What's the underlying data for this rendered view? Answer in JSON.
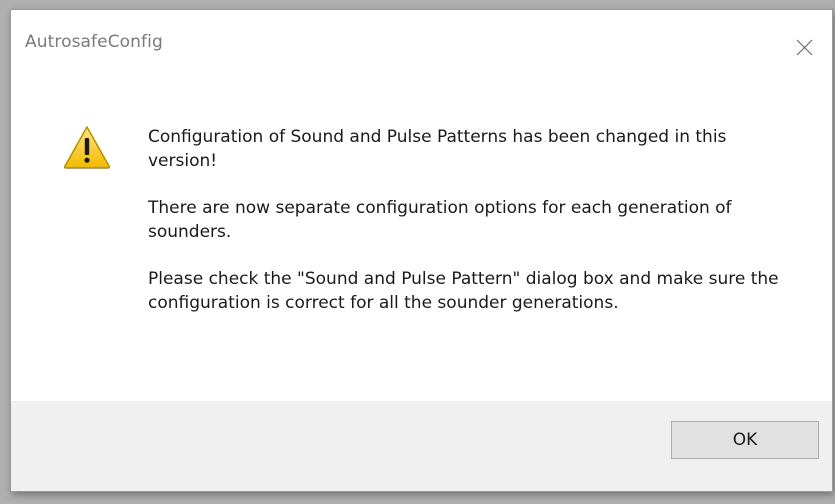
{
  "window": {
    "title": "AutrosafeConfig",
    "close_icon": "close-icon"
  },
  "dialog": {
    "icon": "warning-icon",
    "paragraphs": [
      "Configuration of Sound and Pulse Patterns has been changed in this version!",
      "There are now separate configuration options for each generation of sounders.",
      "Please check the \"Sound and Pulse Pattern\" dialog box and make sure the configuration is correct for all the sounder generations."
    ]
  },
  "buttons": {
    "ok_label": "OK"
  },
  "colors": {
    "warning_yellow": "#f5c400",
    "footer_bg": "#f0f0f0",
    "title_text": "#7a7a7a"
  }
}
